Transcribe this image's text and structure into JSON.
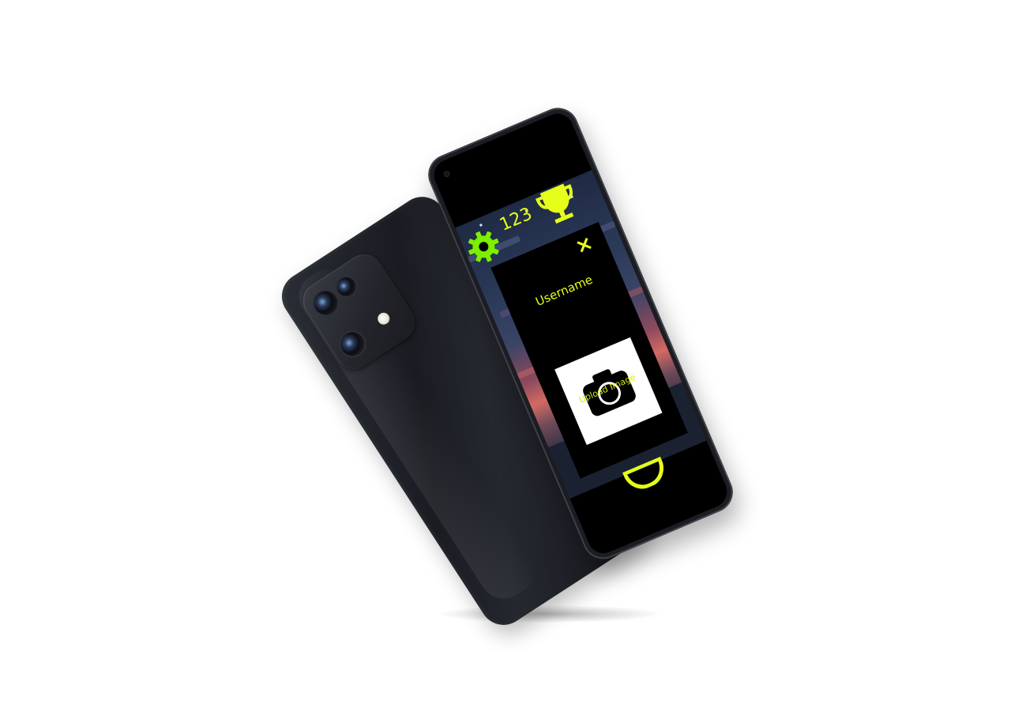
{
  "hud": {
    "score": "123",
    "settings_icon": "gear-icon",
    "trophy_icon": "trophy-icon"
  },
  "modal": {
    "close_label": "×",
    "username_label": "Username",
    "upload_label": "Upload Image",
    "camera_icon": "camera-icon"
  },
  "colors": {
    "accent": "#e6ff1a",
    "modal_bg": "#000000",
    "upload_bg": "#ffffff"
  }
}
